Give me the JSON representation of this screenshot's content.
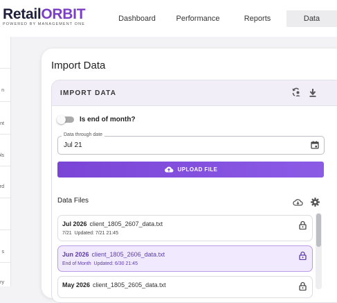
{
  "brand": {
    "name_part1": "Retail",
    "name_part2": "ORBIT",
    "tagline": "POWERED BY MANAGEMENT ONE",
    "accent": "#7b3fc4"
  },
  "nav": {
    "tabs": [
      {
        "label": "Dashboard",
        "active": false
      },
      {
        "label": "Performance",
        "active": false
      },
      {
        "label": "Reports",
        "active": false
      },
      {
        "label": "Data",
        "active": true
      }
    ]
  },
  "sidebar": {
    "items": [
      {
        "label": "n"
      },
      {
        "label": "nt"
      },
      {
        "label": "ols"
      },
      {
        "label": "rd"
      },
      {
        "label": "s"
      },
      {
        "label": "ary"
      }
    ]
  },
  "page": {
    "title": "Import Data"
  },
  "panel": {
    "title": "IMPORT DATA",
    "icons": [
      "sync-user-icon",
      "download-icon"
    ]
  },
  "form": {
    "end_of_month_label": "Is end of month?",
    "end_of_month_on": false,
    "date_field_label": "Data through date",
    "date_field_value": "Jul 21",
    "upload_label": "UPLOAD FILE",
    "upload_color": "#7c47d8"
  },
  "files": {
    "title": "Data Files",
    "items": [
      {
        "month": "Jul 2026",
        "filename": "client_1805_2607_data.txt",
        "period": "7/21",
        "updated": "Updated: 7/21 21:45",
        "selected": false
      },
      {
        "month": "Jun 2026",
        "filename": "client_1805_2606_data.txt",
        "period": "End of Month",
        "updated": "Updated: 6/30 21:45",
        "selected": true
      },
      {
        "month": "May 2026",
        "filename": "client_1805_2605_data.txt",
        "period": "",
        "updated": "",
        "selected": false
      }
    ]
  }
}
